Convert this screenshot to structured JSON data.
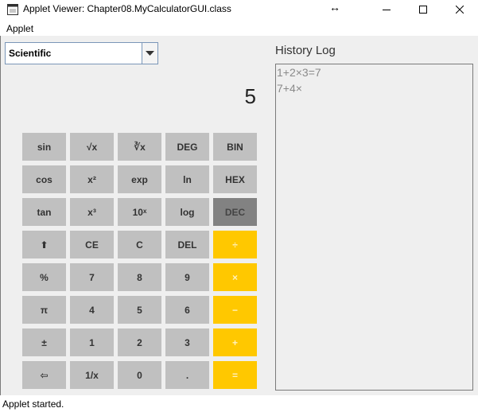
{
  "window": {
    "title": "Applet Viewer: Chapter08.MyCalculatorGUI.class",
    "resize_glyph": "↔"
  },
  "menubar": {
    "items": [
      "Applet"
    ]
  },
  "mode_select": {
    "value": "Scientific"
  },
  "display": {
    "value": "5"
  },
  "keypad": {
    "rows": [
      [
        "sin",
        "√x",
        "∛x",
        "DEG",
        "BIN"
      ],
      [
        "cos",
        "x²",
        "exp",
        "ln",
        "HEX"
      ],
      [
        "tan",
        "x³",
        "10ˣ",
        "log",
        "DEC"
      ],
      [
        "⬆",
        "CE",
        "C",
        "DEL",
        "÷"
      ],
      [
        "%",
        "7",
        "8",
        "9",
        "×"
      ],
      [
        "π",
        "4",
        "5",
        "6",
        "−"
      ],
      [
        "±",
        "1",
        "2",
        "3",
        "+"
      ],
      [
        "⇦",
        "1/x",
        "0",
        ".",
        "="
      ]
    ]
  },
  "history": {
    "title": "History Log",
    "entries": [
      "1+2×3=7",
      "7+4×"
    ]
  },
  "status": {
    "text": "Applet started."
  },
  "colors": {
    "button": "#c0c0c0",
    "button_selected": "#828282",
    "operator": "#ffc800",
    "panel": "#efefef"
  },
  "icons": {
    "app": "java-applet-icon",
    "minimize": "minimize-icon",
    "maximize": "maximize-icon",
    "close": "close-icon",
    "dropdown": "chevron-down-icon"
  }
}
